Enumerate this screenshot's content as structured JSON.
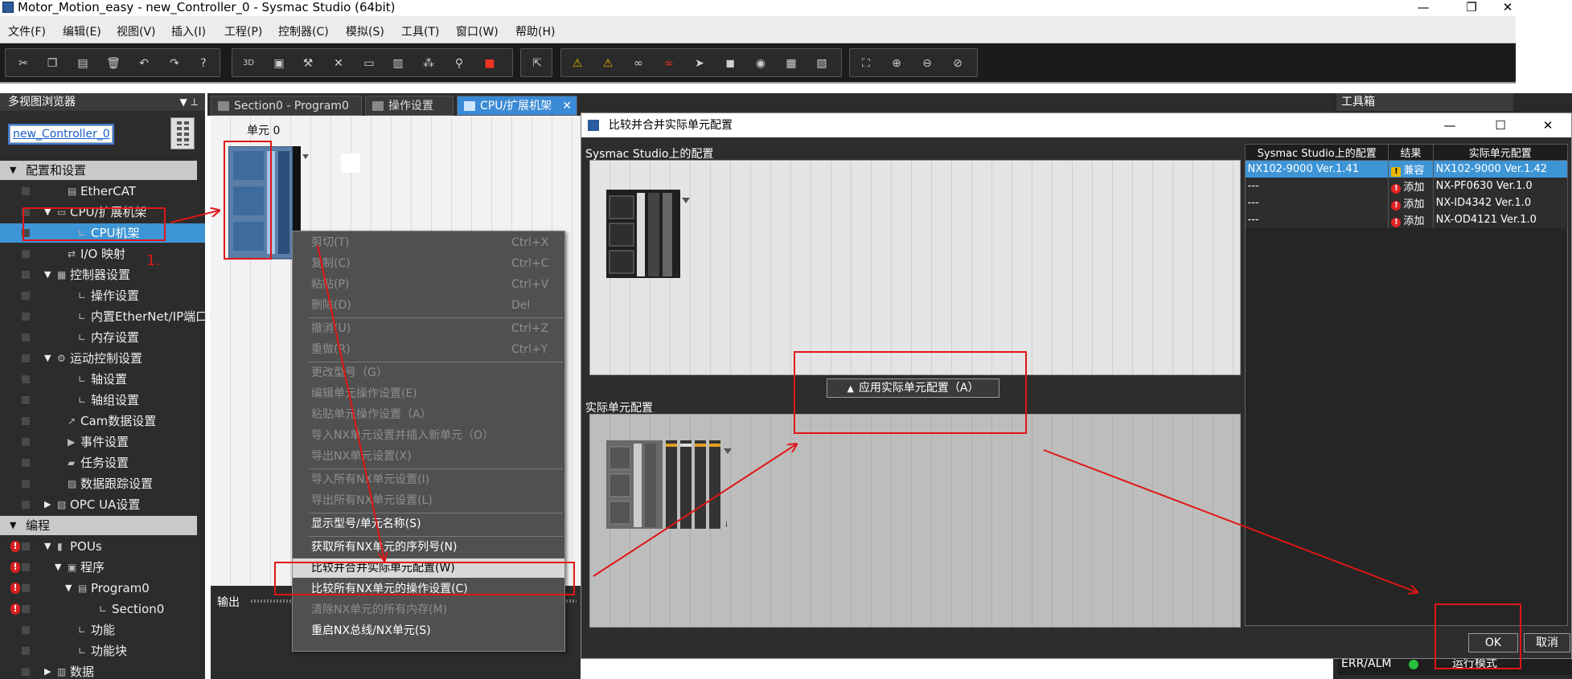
{
  "window": {
    "title": "Motor_Motion_easy - new_Controller_0 - Sysmac Studio (64bit)",
    "min": "—",
    "restore": "❐",
    "close": "✕"
  },
  "menu": [
    "文件(F)",
    "编辑(E)",
    "视图(V)",
    "插入(I)",
    "工程(P)",
    "控制器(C)",
    "模拟(S)",
    "工具(T)",
    "窗口(W)",
    "帮助(H)"
  ],
  "toolbar_icons": [
    "cut-icon",
    "copy-icon",
    "paste-icon",
    "delete-icon",
    "undo-icon",
    "redo-icon",
    "help-icon",
    "3d-icon",
    "window-icon",
    "build-icon",
    "tool-icon",
    "compare-icon",
    "mirror-icon",
    "network-icon",
    "search-icon",
    "error-icon",
    "cursor-icon",
    "warning-icon",
    "warning2-icon",
    "glasses-icon",
    "glasses2-icon",
    "step-icon",
    "stop-icon",
    "refresh-icon",
    "monitor-icon",
    "monitor2-icon",
    "zoom-fit-icon",
    "zoom-in-icon",
    "zoom-out-icon",
    "zoom-reset-icon"
  ],
  "left_panel": {
    "title": "多视图浏览器",
    "pin": "▼ ⊥",
    "controller": "new_Controller_0",
    "tree": [
      {
        "label": "配置和设置",
        "section": true,
        "arrow": "▼",
        "indent": 0
      },
      {
        "label": "EtherCAT",
        "arrow": "",
        "icon": "▤",
        "indent": 2
      },
      {
        "label": "CPU/扩展机架",
        "arrow": "▼",
        "icon": "▭",
        "indent": 1
      },
      {
        "label": "CPU机架",
        "arrow": "",
        "icon": "∟",
        "indent": 3,
        "selected": true
      },
      {
        "label": "I/O 映射",
        "arrow": "",
        "icon": "⇄",
        "indent": 2
      },
      {
        "label": "控制器设置",
        "arrow": "▼",
        "icon": "▦",
        "indent": 1
      },
      {
        "label": "操作设置",
        "arrow": "",
        "icon": "∟",
        "indent": 3
      },
      {
        "label": "内置EtherNet/IP端口设",
        "arrow": "",
        "icon": "∟",
        "indent": 3
      },
      {
        "label": "内存设置",
        "arrow": "",
        "icon": "∟",
        "indent": 3
      },
      {
        "label": "运动控制设置",
        "arrow": "▼",
        "icon": "⚙",
        "indent": 1
      },
      {
        "label": "轴设置",
        "arrow": "",
        "icon": "∟",
        "indent": 3
      },
      {
        "label": "轴组设置",
        "arrow": "",
        "icon": "∟",
        "indent": 3
      },
      {
        "label": "Cam数据设置",
        "arrow": "",
        "icon": "↗",
        "indent": 2
      },
      {
        "label": "事件设置",
        "arrow": "",
        "icon": "▶",
        "indent": 2
      },
      {
        "label": "任务设置",
        "arrow": "",
        "icon": "▰",
        "indent": 2
      },
      {
        "label": "数据跟踪设置",
        "arrow": "",
        "icon": "▨",
        "indent": 2
      },
      {
        "label": "OPC UA设置",
        "arrow": "▶",
        "icon": "▧",
        "indent": 1
      },
      {
        "label": "编程",
        "section": true,
        "arrow": "▼",
        "indent": 0
      },
      {
        "label": "POUs",
        "arrow": "▼",
        "icon": "▮",
        "indent": 1,
        "error": true
      },
      {
        "label": "程序",
        "arrow": "▼",
        "icon": "▣",
        "indent": 2,
        "error": true
      },
      {
        "label": "Program0",
        "arrow": "▼",
        "icon": "▤",
        "indent": 3,
        "error": true
      },
      {
        "label": "Section0",
        "arrow": "",
        "icon": "∟",
        "indent": 5,
        "error": true
      },
      {
        "label": "功能",
        "arrow": "",
        "icon": "∟",
        "indent": 3
      },
      {
        "label": "功能块",
        "arrow": "",
        "icon": "∟",
        "indent": 3
      },
      {
        "label": "数据",
        "arrow": "▶",
        "icon": "▥",
        "indent": 1
      }
    ]
  },
  "tabs": [
    {
      "label": "Section0 - Program0",
      "active": false
    },
    {
      "label": "操作设置",
      "active": false
    },
    {
      "label": "CPU/扩展机架",
      "active": true,
      "close": "✕"
    }
  ],
  "canvas": {
    "unit_label": "单元 0"
  },
  "output": {
    "title": "输出"
  },
  "context_menu": [
    {
      "label": "剪切(T)",
      "shortcut": "Ctrl+X",
      "enabled": false
    },
    {
      "label": "复制(C)",
      "shortcut": "Ctrl+C",
      "enabled": false
    },
    {
      "label": "粘贴(P)",
      "shortcut": "Ctrl+V",
      "enabled": false
    },
    {
      "label": "删除(D)",
      "shortcut": "Del",
      "enabled": false
    },
    {
      "sep": true
    },
    {
      "label": "撤消(U)",
      "shortcut": "Ctrl+Z",
      "enabled": false
    },
    {
      "label": "重做(R)",
      "shortcut": "Ctrl+Y",
      "enabled": false
    },
    {
      "sep": true
    },
    {
      "label": "更改型号（G）",
      "shortcut": "",
      "enabled": false
    },
    {
      "label": "编辑单元操作设置(E)",
      "shortcut": "",
      "enabled": false
    },
    {
      "label": "粘贴单元操作设置（A）",
      "shortcut": "",
      "enabled": false
    },
    {
      "label": "导入NX单元设置并插入新单元（O）",
      "shortcut": "",
      "enabled": false
    },
    {
      "label": "导出NX单元设置(X)",
      "shortcut": "",
      "enabled": false
    },
    {
      "sep": true
    },
    {
      "label": "导入所有NX单元设置(I)",
      "shortcut": "",
      "enabled": false
    },
    {
      "label": "导出所有NX单元设置(L)",
      "shortcut": "",
      "enabled": false
    },
    {
      "sep": true
    },
    {
      "label": "显示型号/单元名称(S)",
      "shortcut": "",
      "enabled": true
    },
    {
      "sep": true
    },
    {
      "label": "获取所有NX单元的序列号(N)",
      "shortcut": "",
      "enabled": true
    },
    {
      "label": "比较并合并实际单元配置(W)",
      "shortcut": "",
      "enabled": true,
      "highlight": true
    },
    {
      "label": "比较所有NX单元的操作设置(C)",
      "shortcut": "",
      "enabled": true
    },
    {
      "label": "清除NX单元的所有内存(M)",
      "shortcut": "",
      "enabled": false
    },
    {
      "label": "重启NX总线/NX单元(S)",
      "shortcut": "",
      "enabled": true
    }
  ],
  "dialog": {
    "title": "比较并合并实际单元配置",
    "min": "—",
    "max": "☐",
    "close": "✕",
    "studio_config_label": "Sysmac Studio上的配置",
    "actual_config_label": "实际单元配置",
    "apply_button": "应用实际单元配置（A）",
    "table": {
      "headers": [
        "Sysmac Studio上的配置",
        "结果",
        "实际单元配置"
      ],
      "rows": [
        {
          "studio": "NX102-9000 Ver.1.41",
          "result": "兼容",
          "kind": "warn",
          "actual": "NX102-9000 Ver.1.42",
          "selected": true
        },
        {
          "studio": "---",
          "result": "添加",
          "kind": "err",
          "actual": "NX-PF0630 Ver.1.0"
        },
        {
          "studio": "---",
          "result": "添加",
          "kind": "err",
          "actual": "NX-ID4342 Ver.1.0"
        },
        {
          "studio": "---",
          "result": "添加",
          "kind": "err",
          "actual": "NX-OD4121 Ver.1.0"
        }
      ]
    },
    "ok": "OK",
    "cancel": "取消"
  },
  "right_panel": {
    "title": "工具箱",
    "status_label": "ERR/ALM",
    "status_mode": "运行模式"
  },
  "annotation": {
    "step_label": "1."
  }
}
